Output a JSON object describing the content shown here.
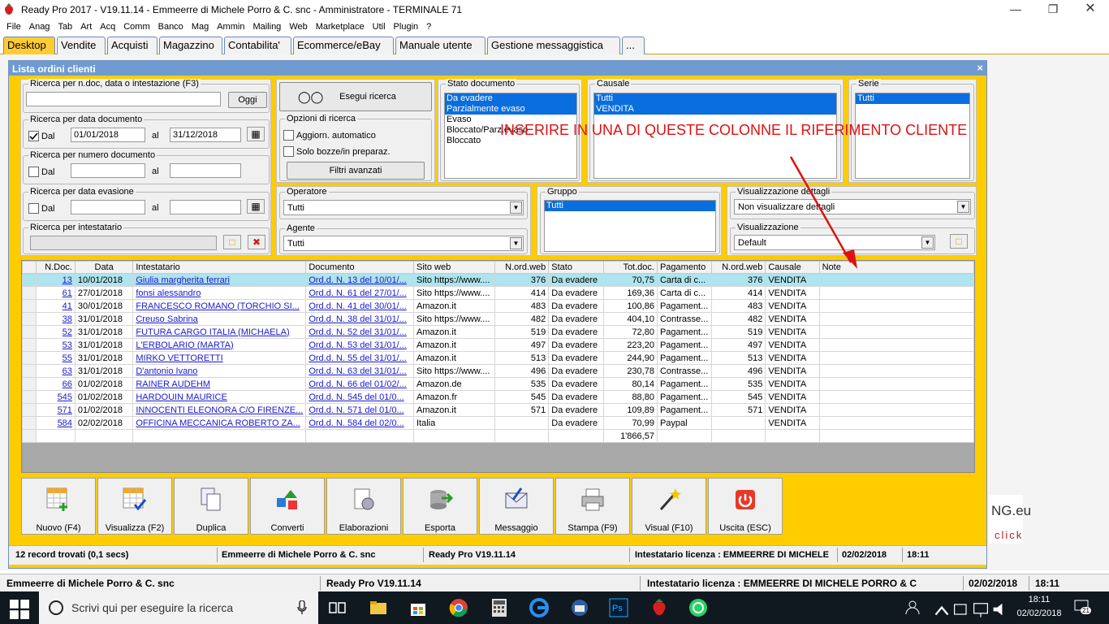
{
  "window": {
    "title": "Ready Pro 2017 - V19.11.14 - Emmeerre di Michele Porro & C. snc - Amministratore - TERMINALE 71"
  },
  "menu": [
    "File",
    "Anag",
    "Tab",
    "Art",
    "Acq",
    "Comm",
    "Banco",
    "Mag",
    "Ammin",
    "Mailing",
    "Web",
    "Marketplace",
    "Util",
    "Plugin",
    "?"
  ],
  "tabs": [
    "Desktop",
    "Vendite",
    "Acquisti",
    "Magazzino",
    "Contabilita'",
    "Ecommerce/eBay",
    "Manuale utente",
    "Gestione messaggistica",
    "..."
  ],
  "inner": {
    "title": "Lista ordini clienti",
    "close": "×"
  },
  "filters": {
    "search_label": "Ricerca per n.doc, data o intestazione (F3)",
    "today_btn": "Oggi",
    "exec_btn": "Esegui ricerca",
    "date_doc_label": "Ricerca per data documento",
    "dal": "Dal",
    "al": "al",
    "date_from": "01/01/2018",
    "date_to": "31/12/2018",
    "num_doc_label": "Ricerca per numero documento",
    "date_ev_label": "Ricerca per data evasione",
    "holder_label": "Ricerca per intestatario",
    "options_label": "Opzioni di ricerca",
    "opt_auto": "Aggiorn. automatico",
    "opt_draft": "Solo bozze/in preparaz.",
    "adv_btn": "Filtri avanzati",
    "operator_label": "Operatore",
    "operator_value": "Tutti",
    "agent_label": "Agente",
    "agent_value": "Tutti",
    "state_label": "Stato documento",
    "state_items": [
      "Da evadere",
      "Parzialmente evaso",
      "Evaso",
      "Bloccato/Parz.evaso",
      "Bloccato"
    ],
    "causal_label": "Causale",
    "causal_items": [
      "Tutti",
      "VENDITA"
    ],
    "series_label": "Serie",
    "series_items": [
      "Tutti"
    ],
    "group_label": "Gruppo",
    "group_items": [
      "Tutti"
    ],
    "details_label": "Visualizzazione dettagli",
    "details_value": "Non visualizzare dettagli",
    "view_label": "Visualizzazione",
    "view_value": "Default"
  },
  "annotation": "INSERIRE IN UNA DI QUESTE COLONNE IL RIFERIMENTO CLIENTE",
  "table": {
    "headers": [
      "N.Doc.",
      "Data",
      "Intestatario",
      "Documento",
      "Sito web",
      "N.ord.web",
      "Stato",
      "Tot.doc.",
      "Pagamento",
      "N.ord.web",
      "Causale",
      "Note"
    ],
    "rows": [
      [
        "13",
        "10/01/2018",
        "Giulia margherita ferrari",
        "Ord.d. N. 13 del 10/01/...",
        "Sito https://www....",
        "376",
        "Da evadere",
        "70,75",
        "Carta di c...",
        "376",
        "VENDITA",
        ""
      ],
      [
        "61",
        "27/01/2018",
        "fonsi alessandro",
        "Ord.d. N. 61 del 27/01/...",
        "Sito https://www....",
        "414",
        "Da evadere",
        "169,36",
        "Carta di c...",
        "414",
        "VENDITA",
        ""
      ],
      [
        "41",
        "30/01/2018",
        " FRANCESCO ROMANO (TORCHIO SI...",
        "Ord.d. N. 41 del 30/01/...",
        "Amazon.it",
        "483",
        "Da evadere",
        "100,86",
        "Pagament...",
        "483",
        "VENDITA",
        ""
      ],
      [
        "38",
        "31/01/2018",
        "Creuso Sabrina",
        "Ord.d. N. 38 del 31/01/...",
        "Sito https://www....",
        "482",
        "Da evadere",
        "404,10",
        "Contrasse...",
        "482",
        "VENDITA",
        ""
      ],
      [
        "52",
        "31/01/2018",
        "FUTURA CARGO ITALIA (MICHAELA)",
        "Ord.d. N. 52 del 31/01/...",
        "Amazon.it",
        "519",
        "Da evadere",
        "72,80",
        "Pagament...",
        "519",
        "VENDITA",
        ""
      ],
      [
        "53",
        "31/01/2018",
        "L'ERBOLARIO (MARTA)",
        "Ord.d. N. 53 del 31/01/...",
        "Amazon.it",
        "497",
        "Da evadere",
        "223,20",
        "Pagament...",
        "497",
        "VENDITA",
        ""
      ],
      [
        "55",
        "31/01/2018",
        "MIRKO VETTORETTI",
        "Ord.d. N. 55 del 31/01/...",
        "Amazon.it",
        "513",
        "Da evadere",
        "244,90",
        "Pagament...",
        "513",
        "VENDITA",
        ""
      ],
      [
        "63",
        "31/01/2018",
        "D'antonio Ivano ",
        "Ord.d. N. 63 del 31/01/...",
        "Sito https://www....",
        "496",
        "Da evadere",
        "230,78",
        "Contrasse...",
        "496",
        "VENDITA",
        ""
      ],
      [
        "66",
        "01/02/2018",
        "RAINER AUDEHM",
        "Ord.d. N. 66 del 01/02/...",
        "Amazon.de",
        "535",
        "Da evadere",
        "80,14",
        "Pagament...",
        "535",
        "VENDITA",
        ""
      ],
      [
        "545",
        "01/02/2018",
        "HARDOUIN MAURICE",
        "Ord.d. N. 545 del 01/0...",
        "Amazon.fr",
        "545",
        "Da evadere",
        "88,80",
        "Pagament...",
        "545",
        "VENDITA",
        ""
      ],
      [
        "571",
        "01/02/2018",
        "INNOCENTI ELEONORA C/O FIRENZE...",
        "Ord.d. N. 571 del 01/0...",
        "Amazon.it",
        "571",
        "Da evadere",
        "109,89",
        "Pagament...",
        "571",
        "VENDITA",
        ""
      ],
      [
        "584",
        "02/02/2018",
        "OFFICINA MECCANICA ROBERTO ZA...",
        "Ord.d. N. 584 del 02/0...",
        "Italia",
        "",
        "Da evadere",
        "70,99",
        "Paypal",
        "",
        "VENDITA",
        ""
      ]
    ],
    "total": "1'866,57"
  },
  "buttons": [
    "Nuovo (F4)",
    "Visualizza (F2)",
    "Duplica",
    "Converti",
    "Elaborazioni",
    "Esporta",
    "Messaggio",
    "Stampa (F9)",
    "Visual (F10)",
    "Uscita (ESC)"
  ],
  "status_inner": {
    "records": "12 record trovati (0,1 secs)",
    "company": "Emmeerre di Michele Porro & C. snc",
    "version": "Ready Pro V19.11.14",
    "license": "Intestatario licenza : EMMEERRE DI MICHELE",
    "date": "02/02/2018",
    "time": "18:11"
  },
  "status_outer": {
    "company": "Emmeerre di Michele Porro & C. snc",
    "version": "Ready Pro V19.11.14",
    "license": "Intestatario licenza : EMMEERRE DI MICHELE PORRO & C",
    "date": "02/02/2018",
    "time": "18:11"
  },
  "logo": {
    "line1": "NG.eu",
    "line2": "click"
  },
  "taskbar": {
    "search_placeholder": "Scrivi qui per eseguire la ricerca",
    "time": "18:11",
    "date": "02/02/2018",
    "notif": "21"
  }
}
